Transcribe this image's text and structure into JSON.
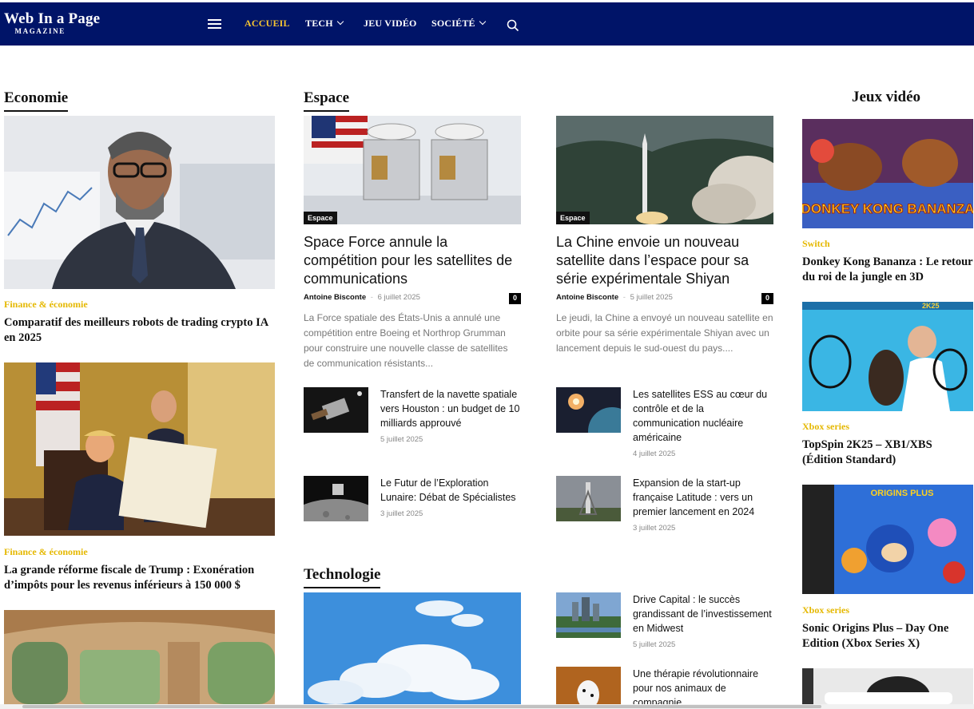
{
  "header": {
    "logo_title": "Web In a Page",
    "logo_sub": "MAGAZINE",
    "nav": [
      {
        "label": "ACCUEIL"
      },
      {
        "label": "TECH"
      },
      {
        "label": "JEU VIDÉO"
      },
      {
        "label": "SOCIÉTÉ"
      }
    ],
    "colors": {
      "bar": "#001468",
      "active": "#f7c531"
    }
  },
  "economie": {
    "heading": "Economie",
    "articles": [
      {
        "category": "Finance & économie",
        "title": "Comparatif des meilleurs robots de trading crypto IA en 2025"
      },
      {
        "category": "Finance & économie",
        "title": "La grande réforme fiscale de Trump : Exonération d’impôts pour les revenus inférieurs à 150 000 $"
      }
    ]
  },
  "espace": {
    "heading": "Espace",
    "featured": [
      {
        "badge": "Espace",
        "title": "Space Force annule la compétition pour les satellites de communications",
        "author": "Antoine Bisconte",
        "date": "6 juillet 2025",
        "comments": "0",
        "excerpt": "La Force spatiale des États-Unis a annulé une compétition entre Boeing et Northrop Grumman pour construire une nouvelle classe de satellites de communication résistants..."
      },
      {
        "badge": "Espace",
        "title": "La Chine envoie un nouveau satellite dans l’espace pour sa série expérimentale Shiyan",
        "author": "Antoine Bisconte",
        "date": "5 juillet 2025",
        "comments": "0",
        "excerpt": "Le jeudi, la Chine a envoyé un nouveau satellite en orbite pour sa série expérimentale Shiyan avec un lancement depuis le sud-ouest du pays...."
      }
    ],
    "list": [
      {
        "title": "Transfert de la navette spatiale vers Houston : un budget de 10 milliards approuvé",
        "date": "5 juillet 2025"
      },
      {
        "title": "Les satellites ESS au cœur du contrôle et de la communication nucléaire américaine",
        "date": "4 juillet 2025"
      },
      {
        "title": "Le Futur de l’Exploration Lunaire: Débat de Spécialistes",
        "date": "3 juillet 2025"
      },
      {
        "title": "Expansion de la start-up française Latitude : vers un premier lancement en 2024",
        "date": "3 juillet 2025"
      }
    ]
  },
  "technologie": {
    "heading": "Technologie",
    "list": [
      {
        "title": "Drive Capital : le succès grandissant de l’investissement en Midwest",
        "date": "5 juillet 2025"
      },
      {
        "title": "Une thérapie révolutionnaire pour nos animaux de compagnie",
        "date": ""
      }
    ]
  },
  "jeux": {
    "heading": "Jeux vidéo",
    "articles": [
      {
        "category": "Switch",
        "title": "Donkey Kong Bananza : Le retour du roi de la jungle en 3D",
        "image_text": "DONKEY KONG BANANZA"
      },
      {
        "category": "Xbox series",
        "title": "TopSpin 2K25 – XB1/XBS (Édition Standard)",
        "image_text": "2K25"
      },
      {
        "category": "Xbox series",
        "title": "Sonic Origins Plus – Day One Edition (Xbox Series X)",
        "image_text": "ORIGINS PLUS"
      }
    ]
  }
}
